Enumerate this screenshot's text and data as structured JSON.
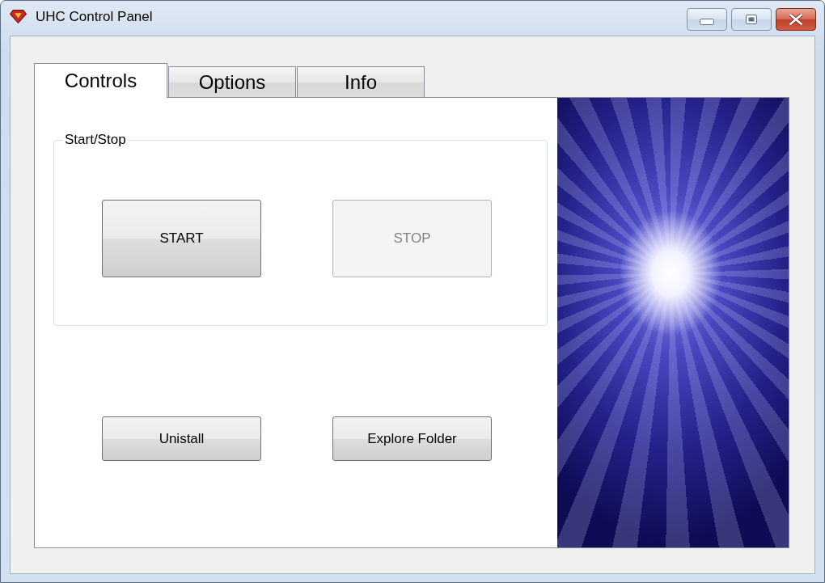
{
  "window": {
    "title": "UHC Control Panel"
  },
  "tabs": [
    {
      "label": "Controls",
      "selected": true
    },
    {
      "label": "Options",
      "selected": false
    },
    {
      "label": "Info",
      "selected": false
    }
  ],
  "group": {
    "legend": "Start/Stop",
    "buttons": [
      {
        "label": "START",
        "disabled": false
      },
      {
        "label": "STOP",
        "disabled": true
      }
    ]
  },
  "buttons": [
    {
      "label": "Unistall",
      "disabled": false
    },
    {
      "label": "Explore Folder",
      "disabled": false
    }
  ]
}
